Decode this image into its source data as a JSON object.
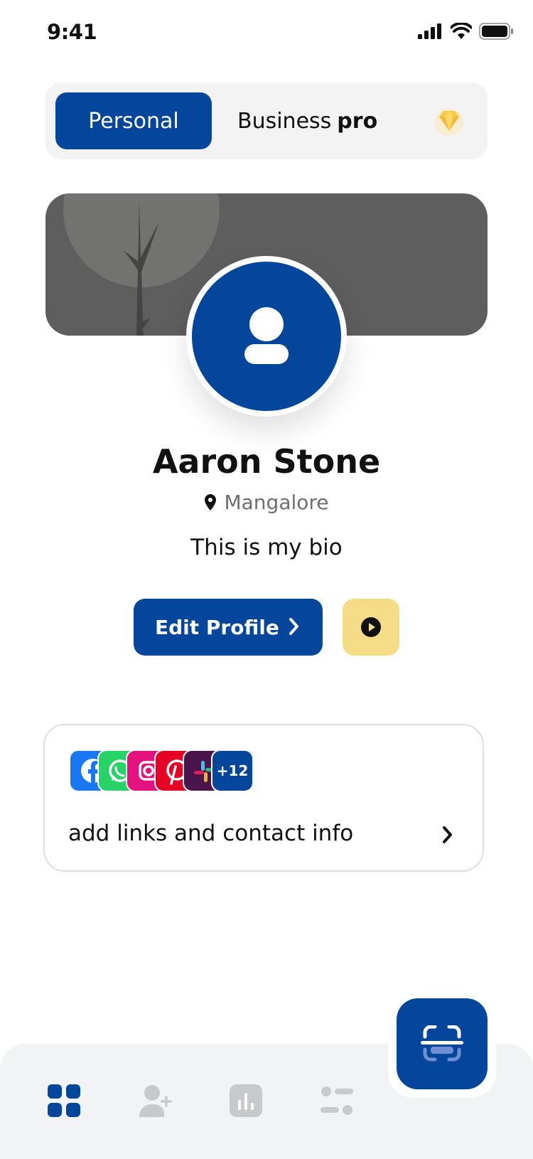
{
  "status_bar": {
    "time": "9:41"
  },
  "mode_toggle": {
    "personal_label": "Personal",
    "business_label": "Business",
    "business_suffix": "pro",
    "premium_icon": "diamond-icon"
  },
  "profile": {
    "name": "Aaron Stone",
    "location": "Mangalore",
    "bio": "This is my bio",
    "avatar_icon": "user-icon"
  },
  "actions": {
    "edit_profile_label": "Edit Profile",
    "play_icon": "play-icon"
  },
  "links_card": {
    "socials": [
      "facebook",
      "whatsapp",
      "instagram",
      "pinterest",
      "slack"
    ],
    "more_count": "+12",
    "label": "add links and contact info"
  },
  "bottom_nav": {
    "items": [
      "grid-icon",
      "add-user-icon",
      "chart-icon",
      "settings-icon"
    ],
    "fab_icon": "scan-icon"
  },
  "colors": {
    "primary": "#04469c",
    "accent_yellow": "#f5dd87",
    "cover": "#5e5e5e"
  }
}
